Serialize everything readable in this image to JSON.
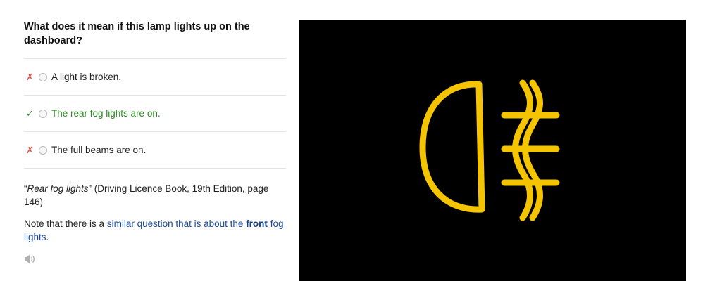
{
  "question": {
    "title": "What does it mean if this lamp lights up on the dashboard?"
  },
  "answers": [
    {
      "mark": "✗",
      "text": "A light is broken.",
      "correct": false
    },
    {
      "mark": "✓",
      "text": "The rear fog lights are on.",
      "correct": true
    },
    {
      "mark": "✗",
      "text": "The full beams are on.",
      "correct": false
    }
  ],
  "citation": {
    "open_quote": "“",
    "title": "Rear fog lights",
    "rest": "” (Driving Licence Book, 19th Edition, page 146)"
  },
  "note": {
    "prefix": "Note that there is a ",
    "link_before": "similar question that is about the ",
    "link_bold": "front",
    "link_after": " fog lights",
    "suffix": "."
  },
  "icons": {
    "audio": "speaker-icon",
    "lamp": "rear-fog-light-icon"
  },
  "colors": {
    "wrong": "#e04a3f",
    "correct": "#2a8a1f",
    "link": "#1a4aa0",
    "lamp": "#f5c400",
    "image_background": "#000000"
  }
}
